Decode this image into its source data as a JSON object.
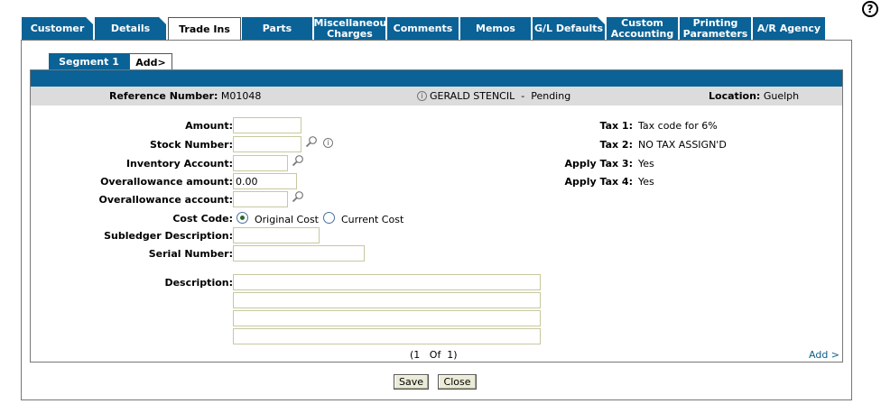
{
  "help": {
    "label": "?"
  },
  "tabs": [
    {
      "label": "Customer"
    },
    {
      "label": "Details"
    },
    {
      "label": "Trade Ins"
    },
    {
      "label": "Parts"
    },
    {
      "label": "Miscellaneous Charges"
    },
    {
      "label": "Comments"
    },
    {
      "label": "Memos"
    },
    {
      "label": "G/L Defaults"
    },
    {
      "label": "Custom Accounting"
    },
    {
      "label": "Printing Parameters"
    },
    {
      "label": "A/R Agency"
    }
  ],
  "segments": {
    "active": "Segment 1",
    "add": "Add>"
  },
  "header": {
    "ref_label": "Reference Number:",
    "ref_value": "M01048",
    "customer": "GERALD STENCIL",
    "separator": "-",
    "status": "Pending",
    "loc_label": "Location:",
    "loc_value": "Guelph"
  },
  "form": {
    "amount_label": "Amount:",
    "amount_value": "",
    "stock_label": "Stock Number:",
    "stock_value": "",
    "inventory_label": "Inventory Account:",
    "inventory_value": "",
    "overallowance_amount_label": "Overallowance amount:",
    "overallowance_amount_value": "0.00",
    "overallowance_account_label": "Overallowance account:",
    "overallowance_account_value": "",
    "cost_code_label": "Cost Code:",
    "cost_original": "Original Cost",
    "cost_current": "Current Cost",
    "subledger_label": "Subledger Description:",
    "subledger_value": "",
    "serial_label": "Serial Number:",
    "serial_value": "",
    "description_label": "Description:",
    "description_lines": [
      "",
      "",
      "",
      ""
    ]
  },
  "taxes": {
    "tax1_label": "Tax 1:",
    "tax1_value": "Tax code for 6%",
    "tax2_label": "Tax 2:",
    "tax2_value": "NO TAX ASSIGN'D",
    "tax3_label": "Apply Tax 3:",
    "tax3_value": "Yes",
    "tax4_label": "Apply Tax 4:",
    "tax4_value": "Yes"
  },
  "pagination": {
    "text": "(1   Of  1)"
  },
  "add_link": "Add >",
  "buttons": {
    "save": "Save",
    "close": "Close"
  }
}
